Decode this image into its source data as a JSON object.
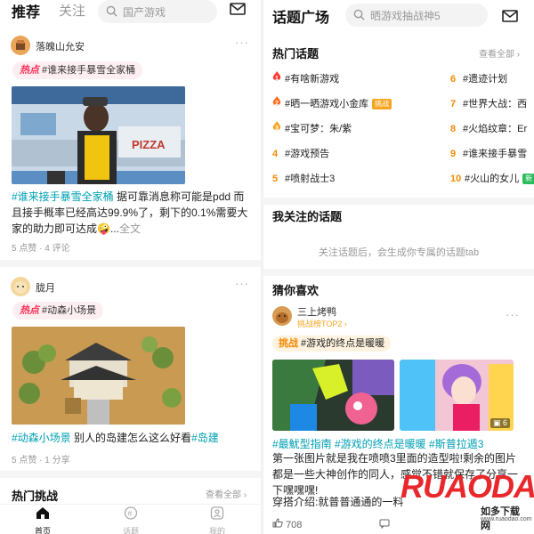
{
  "left": {
    "tabs": {
      "active": "推荐",
      "other": "关注"
    },
    "search_placeholder": "国产游戏",
    "post1": {
      "user": "落魄山允安",
      "tag_kind": "热点",
      "tag_text": "#谁来接手暴雪全家桶",
      "text_hashtag": "#谁来接手暴雪全家桶",
      "text_body": " 据可靠消息称可能是pdd 而且接手概率已经高达99.9%了，剩下的0.1%需要大家的助力即可达成🤪...",
      "fold": "全文",
      "meta": "5 点赞 · 4 评论",
      "image_text": "PIZZA"
    },
    "post2": {
      "user": "胧月",
      "tag_kind": "热点",
      "tag_text": "#动森小场景",
      "text_tag1": "#动森小场景",
      "text_body": " 别人的岛建怎么这么好看",
      "text_tag2": "#岛建",
      "meta": "5 点赞 · 1 分享"
    },
    "hot_challenge": {
      "title": "热门挑战",
      "see_all": "查看全部 ›"
    },
    "nav": [
      {
        "label": "首页",
        "icon": "home-icon"
      },
      {
        "label": "话题",
        "icon": "topic-icon"
      },
      {
        "label": "我的",
        "icon": "profile-icon"
      }
    ]
  },
  "right": {
    "title": "话题广场",
    "search_placeholder": "晒游戏抽战神5",
    "hot_topics": {
      "title": "热门话题",
      "see_all": "查看全部 ›",
      "items": [
        {
          "rank": "1",
          "text": "#有啥新游戏",
          "badge": ""
        },
        {
          "rank": "2",
          "text": "#晒一晒游戏小金库",
          "badge": "挑战"
        },
        {
          "rank": "3",
          "text": "#宝可梦：朱/紫",
          "badge": ""
        },
        {
          "rank": "4",
          "text": "#游戏预告",
          "badge": ""
        },
        {
          "rank": "5",
          "text": "#喷射战士3",
          "badge": ""
        },
        {
          "rank": "6",
          "text": "#遗迹计划",
          "badge": ""
        },
        {
          "rank": "7",
          "text": "#世界大战：西",
          "badge": ""
        },
        {
          "rank": "8",
          "text": "#火焰纹章：Er",
          "badge": ""
        },
        {
          "rank": "9",
          "text": "#谁来接手暴雪",
          "badge": ""
        },
        {
          "rank": "10",
          "text": "#火山的女儿",
          "badge": "新"
        }
      ]
    },
    "followed": {
      "title": "我关注的话题",
      "empty": "关注话题后，会生成你专属的话题tab"
    },
    "guess": {
      "title": "猜你喜欢",
      "user": "三上烤鸭",
      "rank_line": "挑战榜TOP2 ›",
      "tag_kind": "挑战",
      "tag_text": "#游戏的终点是暖暖",
      "image_count": "6",
      "tags": "#最魷型指南  #游戏的终点是暖暖  #斯普拉遁3",
      "body": "第一张图片就是我在喷喷3里面的造型啦!剩余的图片都是一些大神创作的同人，感觉不错就保存了分享一下嘿嘿嘿!",
      "body2": "穿搭介绍:就普普通通的一料",
      "likes": "708"
    },
    "watermark": {
      "brand": "RUAODAO",
      "site": "如多下载网",
      "url": "www.ruaodao.com"
    }
  }
}
